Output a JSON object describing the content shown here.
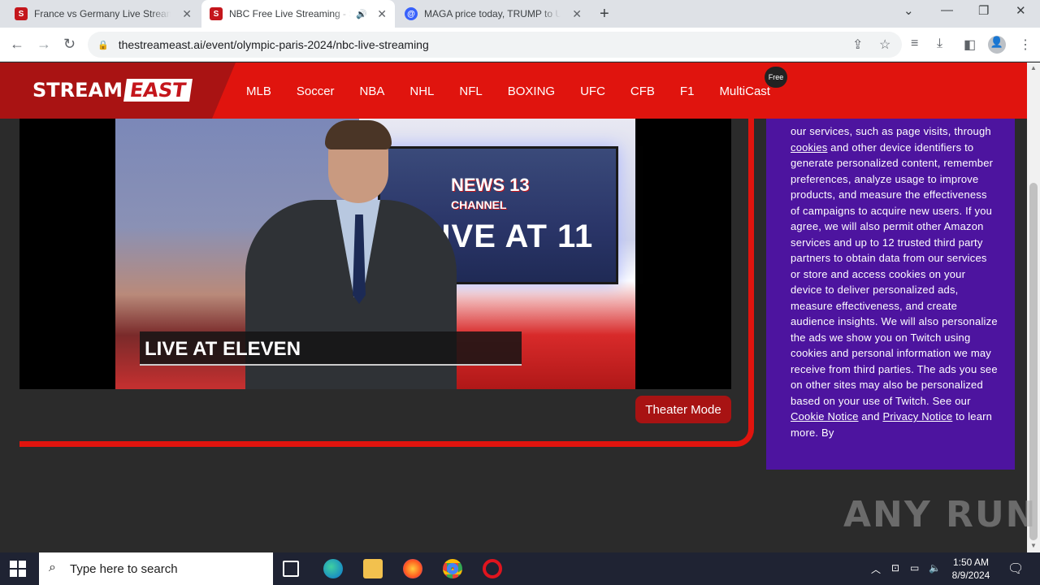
{
  "browser": {
    "tabs": [
      {
        "title": "France vs Germany Live Streaming",
        "favicon": "S",
        "favicon_color": "#c4161c",
        "active": false
      },
      {
        "title": "NBC Free Live Streaming - Stream",
        "favicon": "S",
        "favicon_color": "#c4161c",
        "active": true
      },
      {
        "title": "MAGA price today, TRUMP to USD",
        "favicon": "@",
        "favicon_color": "#3861fb",
        "active": false
      }
    ],
    "new_tab": "+",
    "url": "thestreameast.ai/event/olympic-paris-2024/nbc-live-streaming"
  },
  "site": {
    "logo_left": "STREAM",
    "logo_right": "EAST",
    "menu": [
      "MLB",
      "Soccer",
      "NBA",
      "NHL",
      "NFL",
      "BOXING",
      "UFC",
      "CFB",
      "F1",
      "MultiCast"
    ],
    "free_badge": "Free",
    "theater_mode": "Theater Mode"
  },
  "video": {
    "monitor_top": "NEWS 13",
    "monitor_sub": "CHANNEL",
    "monitor_live": "LIVE AT 11",
    "lower_third": "LIVE AT ELEVEN"
  },
  "consent": {
    "text_1": "our services, such as page visits, through ",
    "link_cookies": "cookies",
    "text_2": " and other device identifiers to generate personalized content, remember preferences, analyze usage to improve products, and measure the effectiveness of campaigns to acquire new users. If you agree, we will also permit other Amazon services and up to 12 trusted third party partners to obtain data from our services or store and access cookies on your device to deliver personalized ads, measure effectiveness, and create audience insights. We will also personalize the ads we show you on Twitch using cookies and personal information we may receive from third parties. The ads you see on other sites may also be personalized based on your use of Twitch. See our ",
    "link_cookie_notice": "Cookie Notice",
    "text_3": " and ",
    "link_privacy": "Privacy Notice",
    "text_4": " to learn more. By"
  },
  "watermark": "ANY RUN",
  "taskbar": {
    "search_placeholder": "Type here to search",
    "time": "1:50 AM",
    "date": "8/9/2024"
  }
}
